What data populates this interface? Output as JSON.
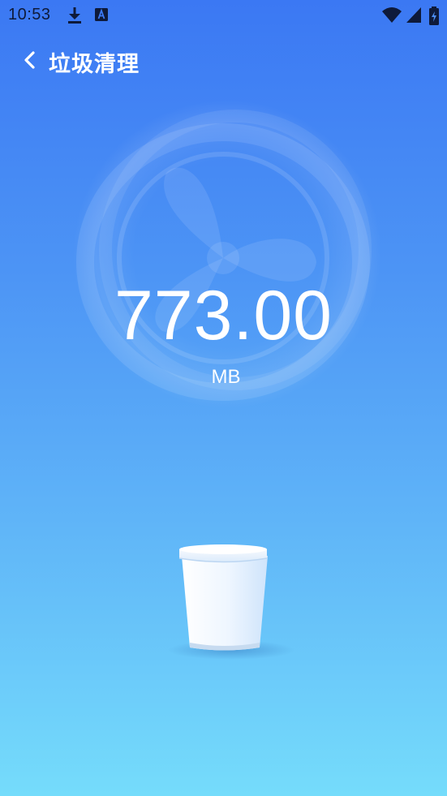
{
  "status_bar": {
    "time": "10:53",
    "icons": [
      "download-icon",
      "a-box-icon",
      "wifi-icon",
      "signal-icon",
      "battery-charging-icon"
    ]
  },
  "header": {
    "back_icon": "chevron-left-icon",
    "title": "垃圾清理"
  },
  "scan": {
    "size_value": "773.00",
    "size_unit": "MB"
  },
  "colors": {
    "gradient_top": "#3b78f3",
    "gradient_bottom": "#75dcfb",
    "text": "#ffffff",
    "status_text": "#0e1a3a"
  }
}
